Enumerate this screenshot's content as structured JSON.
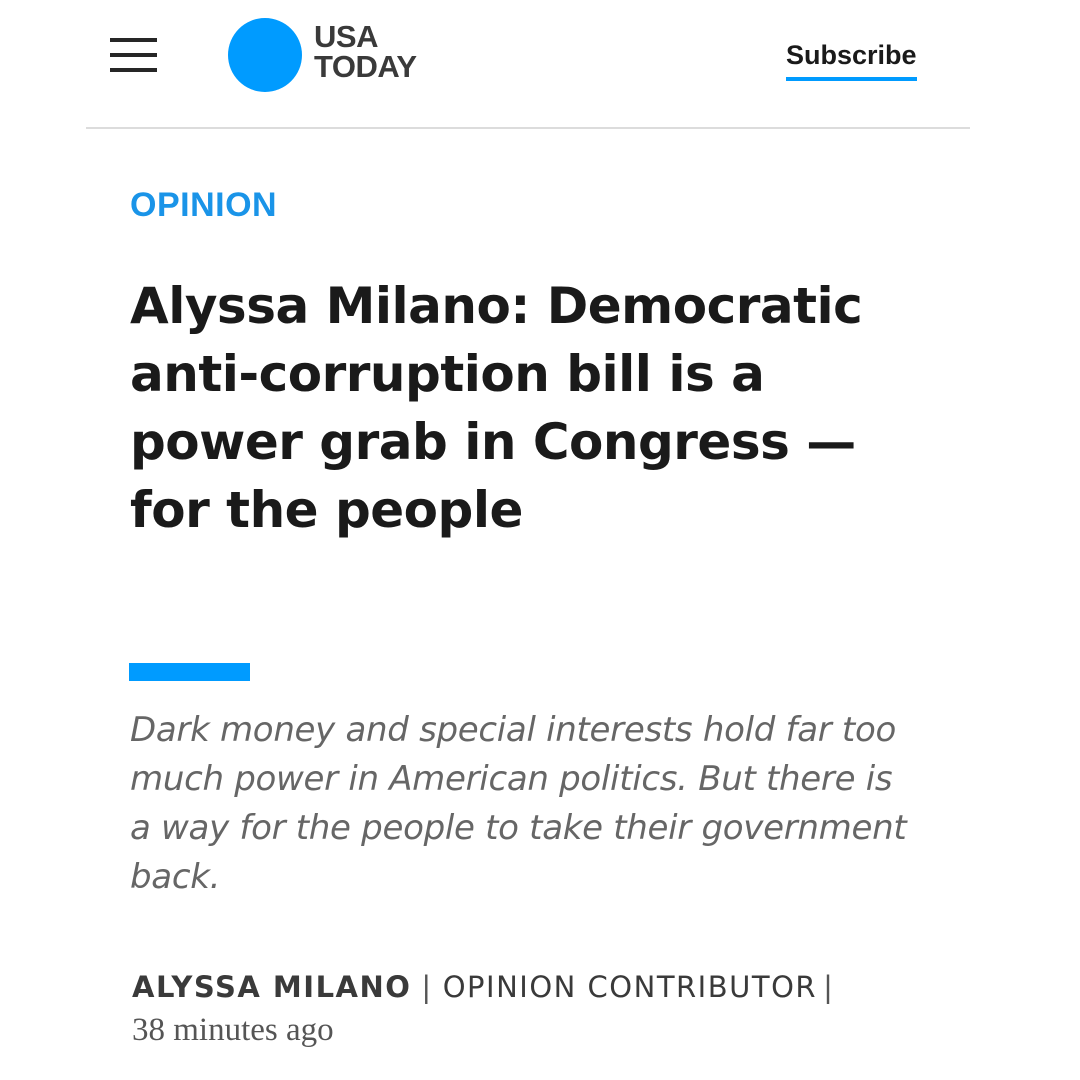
{
  "header": {
    "menu_icon": "hamburger-menu-icon",
    "logo": {
      "line1": "USA",
      "line2": "TODAY",
      "dot_color": "#009bff"
    },
    "subscribe_label": "Subscribe"
  },
  "article": {
    "section": "OPINION",
    "headline": "Alyssa Milano: Democratic anti-corruption bill is a power grab in Congress — for the people",
    "summary": "Dark money and special interests hold far too much power in American politics. But there is a way for the people to take their government back.",
    "byline": {
      "author": "ALYSSA MILANO",
      "separator": "|",
      "role": "OPINION CONTRIBUTOR",
      "trailing_separator": "|"
    },
    "timestamp": "38 minutes ago"
  },
  "colors": {
    "accent": "#009bff",
    "section_label": "#1a94e8",
    "headline": "#1a1a1a",
    "summary": "#666666"
  }
}
